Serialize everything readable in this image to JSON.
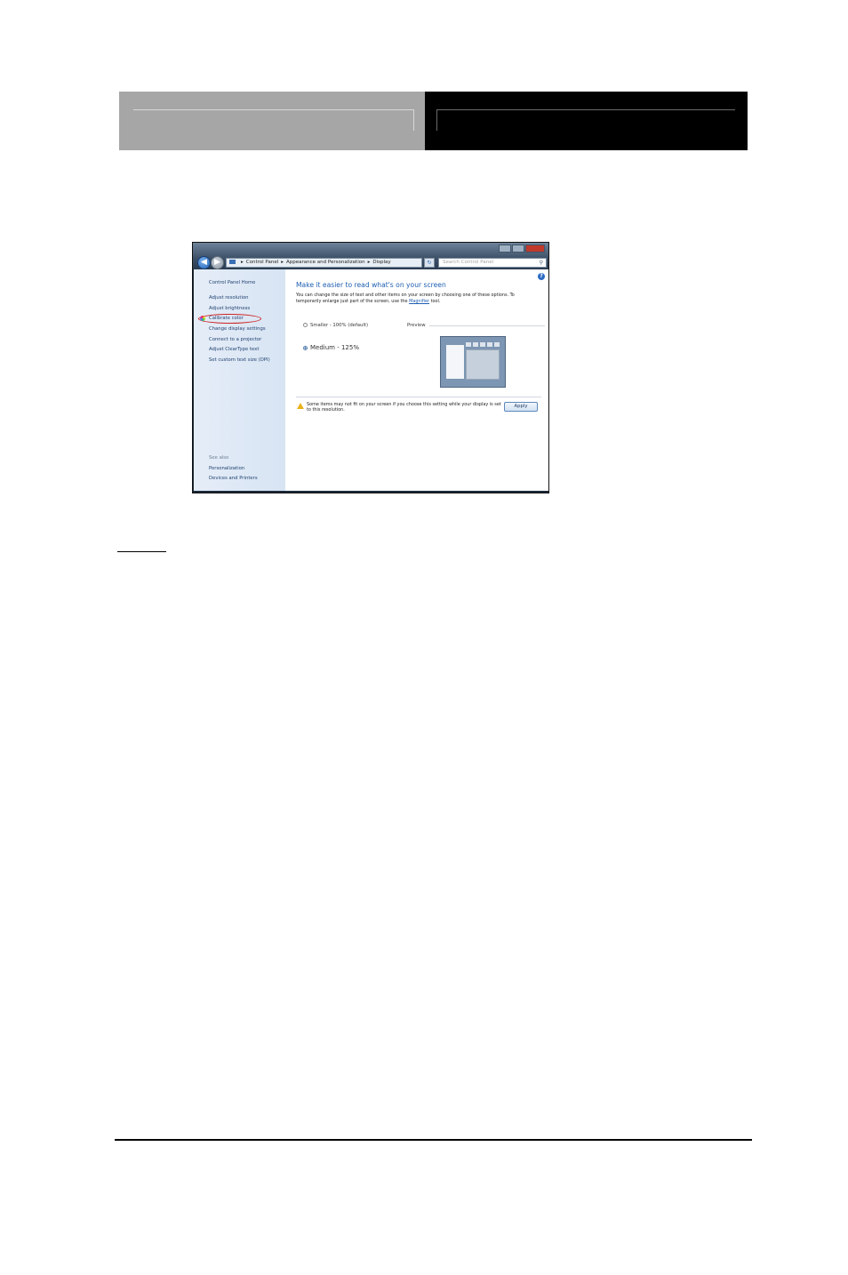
{
  "window": {
    "address_parts": [
      "Control Panel",
      "Appearance and Personalization",
      "Display"
    ],
    "search_placeholder": "Search Control Panel",
    "sidebar": {
      "home": "Control Panel Home",
      "tasks": [
        "Adjust resolution",
        "Adjust brightness",
        "Calibrate color",
        "Change display settings",
        "Connect to a projector",
        "Adjust ClearType text",
        "Set custom text size (DPI)"
      ],
      "see_also_label": "See also",
      "see_also": [
        "Personalization",
        "Devices and Printers"
      ]
    },
    "content": {
      "title": "Make it easier to read what's on your screen",
      "description_pre": "You can change the size of text and other items on your screen by choosing one of these options. To temporarily enlarge just part of the screen, use the",
      "description_link": "Magnifier",
      "description_post": "tool.",
      "options": [
        {
          "label": "Smaller - 100% (default)",
          "selected": false
        },
        {
          "label": "Medium - 125%",
          "selected": true
        }
      ],
      "preview_label": "Preview",
      "warning": "Some items may not fit on your screen if you choose this setting while your display is set to this resolution.",
      "apply_label": "Apply"
    }
  },
  "colors": {
    "header_left": "#a6a6a6",
    "header_right": "#000000",
    "highlight_ring": "#cc2222",
    "link": "#1f5fb2"
  }
}
